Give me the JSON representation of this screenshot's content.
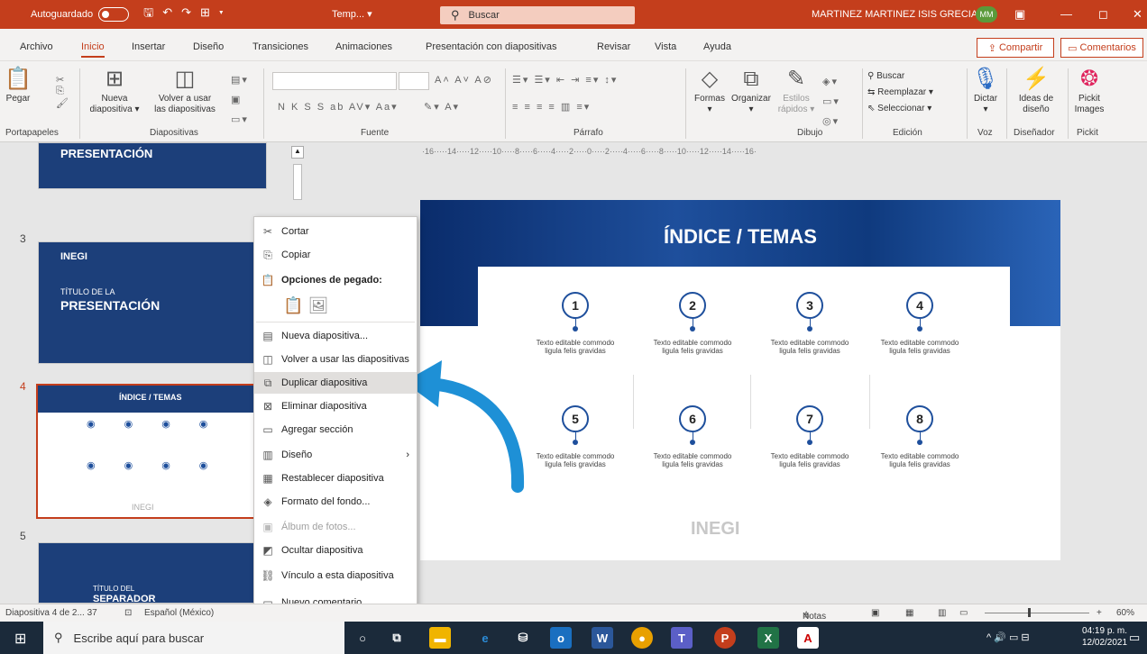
{
  "titlebar": {
    "autosave_label": "Autoguardado",
    "doc_name": "Temp... ▾",
    "search_label": "Buscar",
    "user_name": "MARTINEZ MARTINEZ ISIS GRECIA",
    "avatar": "MM",
    "colors": {
      "brand": "#c43e1c"
    }
  },
  "tabs": [
    "Archivo",
    "Inicio",
    "Insertar",
    "Diseño",
    "Transiciones",
    "Animaciones",
    "Presentación con diapositivas",
    "Revisar",
    "Vista",
    "Ayuda"
  ],
  "share_label": "Compartir",
  "comments_label": "Comentarios",
  "ribbon": {
    "paste": "Pegar",
    "new_slide_1": "Nueva",
    "new_slide_2": "diapositiva ▾",
    "reuse_1": "Volver a usar",
    "reuse_2": "las diapositivas",
    "bold_row": "N K S S ab AV▾ Aa▾",
    "shapes": "Formas",
    "arrange": "Organizar",
    "quick_styles_1": "Estilos",
    "quick_styles_2": "rápidos ▾",
    "find": "Buscar",
    "replace": "Reemplazar ▾",
    "select": "Seleccionar ▾",
    "dictate": "Dictar",
    "design_ideas_1": "Ideas de",
    "design_ideas_2": "diseño",
    "pickit_1": "Pickit",
    "pickit_2": "Images",
    "groups": {
      "clipboard": "Portapapeles",
      "slides": "Diapositivas",
      "font": "Fuente",
      "paragraph": "Párrafo",
      "drawing": "Dibujo",
      "editing": "Edición",
      "voice": "Voz",
      "designer": "Diseñador",
      "pickit": "Pickit"
    }
  },
  "ruler": "·16·····14·····12·····10·····8·····6·····4·····2·····0·····2·····4·····6·····8·····10·····12·····14·····16·",
  "thumbnails": {
    "prev_title": "PRESENTACIÓN",
    "slide3_num": "3",
    "slide3_brand": "INEGI",
    "slide3_sub": "TÍTULO DE LA",
    "slide3_title": "PRESENTACIÓN",
    "slide4_num": "4",
    "slide4_title": "ÍNDICE / TEMAS",
    "slide4_logo": "INEGI",
    "slide5_num": "5",
    "slide5_sub": "TÍTULO DEL",
    "slide5_title": "SEPARADOR"
  },
  "slide": {
    "title": "ÍNDICE / TEMAS",
    "topic_text": "Texto editable commodo ligula felis gravidas",
    "topics": [
      "1",
      "2",
      "3",
      "4",
      "5",
      "6",
      "7",
      "8"
    ],
    "logo": "INEGI"
  },
  "context_menu": {
    "items": [
      {
        "label": "Cortar",
        "icon": "scissors-icon"
      },
      {
        "label": "Copiar",
        "icon": "copy-icon"
      },
      {
        "label": "Opciones de pegado:",
        "icon": "paste-icon"
      },
      {
        "label": "Nueva diapositiva...",
        "icon": "new-slide-icon"
      },
      {
        "label": "Volver a usar las diapositivas",
        "icon": "reuse-slides-icon"
      },
      {
        "label": "Duplicar diapositiva",
        "icon": "duplicate-icon"
      },
      {
        "label": "Eliminar diapositiva",
        "icon": "delete-slide-icon"
      },
      {
        "label": "Agregar sección",
        "icon": "section-icon"
      },
      {
        "label": "Diseño",
        "icon": "layout-icon"
      },
      {
        "label": "Restablecer diapositiva",
        "icon": "reset-icon"
      },
      {
        "label": "Formato del fondo...",
        "icon": "background-icon"
      },
      {
        "label": "Álbum de fotos...",
        "icon": "album-icon"
      },
      {
        "label": "Ocultar diapositiva",
        "icon": "hide-icon"
      },
      {
        "label": "Vínculo a esta diapositiva",
        "icon": "link-icon"
      },
      {
        "label": "Nuevo comentario",
        "icon": "comment-icon"
      }
    ]
  },
  "statusbar": {
    "slide_info": "Diapositiva 4 de 2... 37",
    "language": "Español (México)",
    "notes": "Notas",
    "zoom": "60%"
  },
  "taskbar": {
    "search_placeholder": "Escribe aquí para buscar",
    "time": "04:19 p. m.",
    "date": "12/02/2021"
  }
}
